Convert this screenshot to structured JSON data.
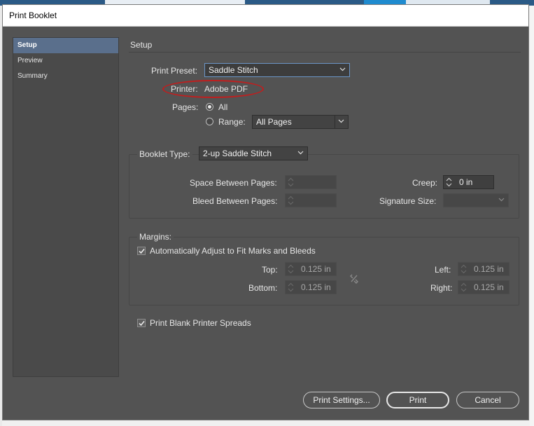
{
  "window": {
    "title": "Print Booklet"
  },
  "sidebar": {
    "items": [
      {
        "label": "Setup",
        "active": true
      },
      {
        "label": "Preview",
        "active": false
      },
      {
        "label": "Summary",
        "active": false
      }
    ]
  },
  "main": {
    "section_title": "Setup",
    "print_preset": {
      "label": "Print Preset:",
      "value": "Saddle Stitch"
    },
    "printer": {
      "label": "Printer:",
      "value": "Adobe PDF"
    },
    "pages": {
      "label": "Pages:",
      "all_label": "All",
      "range_label": "Range:",
      "range_value": "All Pages",
      "selected": "All"
    },
    "booklet": {
      "label": "Booklet Type:",
      "value": "2-up Saddle Stitch",
      "space_between_label": "Space Between Pages:",
      "space_between_value": "",
      "bleed_between_label": "Bleed Between Pages:",
      "bleed_between_value": "",
      "creep_label": "Creep:",
      "creep_value": "0 in",
      "signature_label": "Signature Size:",
      "signature_value": ""
    },
    "margins": {
      "label": "Margins:",
      "auto_adjust_label": "Automatically Adjust to Fit Marks and Bleeds",
      "auto_adjust_checked": true,
      "top_label": "Top:",
      "top_value": "0.125 in",
      "bottom_label": "Bottom:",
      "bottom_value": "0.125 in",
      "left_label": "Left:",
      "left_value": "0.125 in",
      "right_label": "Right:",
      "right_value": "0.125 in"
    },
    "blank_spreads": {
      "label": "Print Blank Printer Spreads",
      "checked": true
    }
  },
  "buttons": {
    "print_settings": "Print Settings...",
    "print": "Print",
    "cancel": "Cancel"
  },
  "colors": {
    "dialog_bg": "#535353",
    "sidebar_active": "#5a6f8c",
    "annotation_red": "#c01e1e"
  },
  "icons": [
    "chevron-down-icon",
    "spinner-arrows-icon",
    "chain-link-icon",
    "checkmark-icon"
  ]
}
